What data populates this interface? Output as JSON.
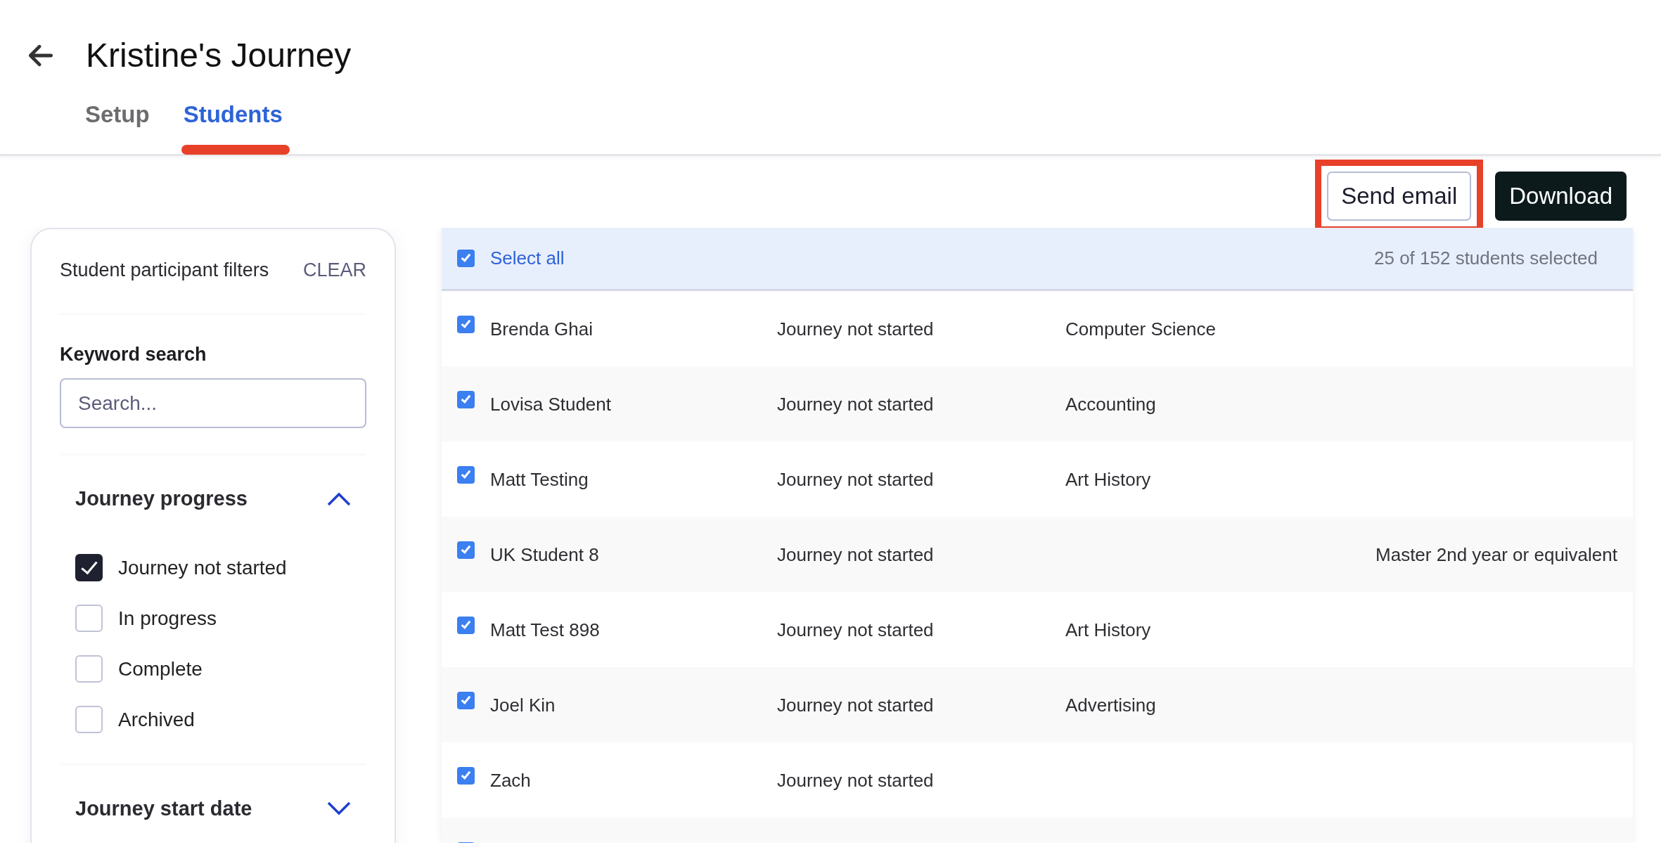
{
  "page": {
    "title": "Kristine's Journey"
  },
  "tabs": [
    {
      "label": "Setup",
      "selected": false,
      "annotated": false
    },
    {
      "label": "Students",
      "selected": true,
      "annotated": true
    }
  ],
  "actions": [
    {
      "label": "Send email",
      "kind": "outline",
      "highlighted": true
    },
    {
      "label": "Download",
      "kind": "dark",
      "highlighted": false
    }
  ],
  "filters": {
    "title": "Student participant filters",
    "clear": "CLEAR",
    "keyword_search": {
      "label": "Keyword search",
      "placeholder": "Search..."
    },
    "sections": [
      {
        "title": "Journey progress",
        "expanded": true,
        "options": [
          {
            "label": "Journey not started",
            "checked": true
          },
          {
            "label": "In progress",
            "checked": false
          },
          {
            "label": "Complete",
            "checked": false
          },
          {
            "label": "Archived",
            "checked": false
          }
        ]
      },
      {
        "title": "Journey start date",
        "expanded": false
      }
    ]
  },
  "table": {
    "select_all": {
      "label": "Select all",
      "checked": true
    },
    "selection_count": "25 of 152 students selected",
    "rows": [
      {
        "name": "Brenda Ghai",
        "status": "Journey not started",
        "column_3": "Computer Science",
        "selected": true
      },
      {
        "name": "Lovisa Student",
        "status": "Journey not started",
        "column_3": "Accounting",
        "selected": true
      },
      {
        "name": "Matt Testing",
        "status": "Journey not started",
        "column_3": "Art History",
        "selected": true
      },
      {
        "name": "UK Student 8",
        "status": "Journey not started",
        "column_4": "Master 2nd year or equivalent",
        "selected": true
      },
      {
        "name": "Matt Test 898",
        "status": "Journey not started",
        "column_3": "Art History",
        "selected": true
      },
      {
        "name": "Joel Kin",
        "status": "Journey not started",
        "column_3": "Advertising",
        "selected": true
      },
      {
        "name": "Zach",
        "status": "Journey not started",
        "selected": true
      },
      {
        "selected": true
      }
    ]
  }
}
